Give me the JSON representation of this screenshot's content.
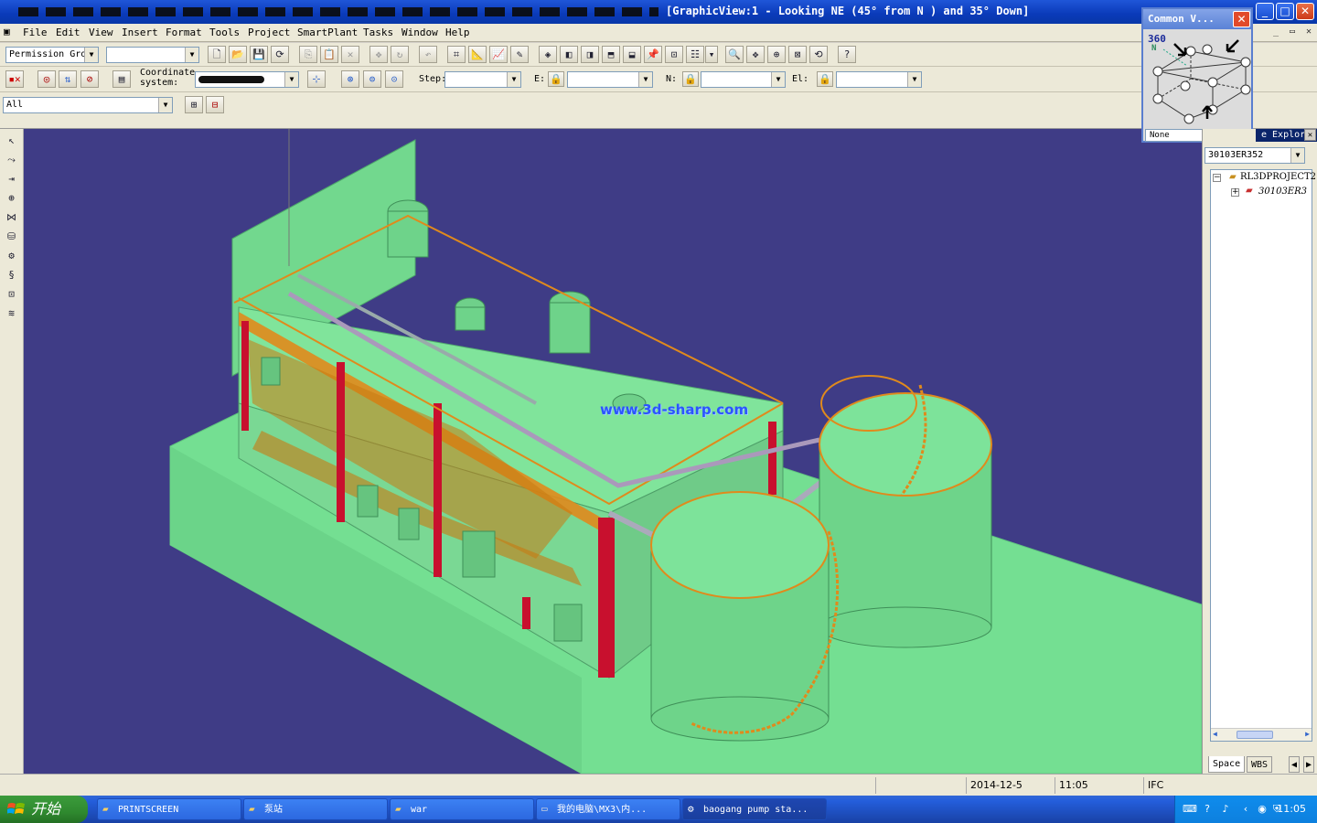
{
  "window": {
    "title": "[GraphicView:1 - Looking NE (45° from N ) and 35° Down]",
    "min": "_",
    "max": "□",
    "close": "✕"
  },
  "menu": [
    "File",
    "Edit",
    "View",
    "Insert",
    "Format",
    "Tools",
    "Project",
    "SmartPlant",
    "Tasks",
    "Window",
    "Help"
  ],
  "mdi": {
    "min": "_",
    "restore": "▭",
    "close": "✕"
  },
  "toolbar1": {
    "permission_group": "Permission Gro",
    "second_combo": ""
  },
  "toolbar2": {
    "coord_label": "Coordinate\nsystem:",
    "step_label": "Step:",
    "e_label": "E:",
    "n_label": "N:",
    "el_label": "El:"
  },
  "toolbar3": {
    "filter": "All"
  },
  "common_views": {
    "title": "Common V...",
    "badge": "360",
    "n": "N",
    "combo": "None",
    "close": "✕"
  },
  "explorer": {
    "title": "e Explor",
    "close": "✕",
    "combo": "30103ER352",
    "tree": [
      {
        "label": "RL3DPROJECT2",
        "expander": "−"
      },
      {
        "label": "30103ER3",
        "expander": "+"
      }
    ],
    "tabs": [
      "Space",
      "WBS"
    ],
    "scroll_left": "◀",
    "scroll_right": "▶"
  },
  "viewport": {
    "watermark": "www.3d-sharp.com"
  },
  "statusbar": {
    "date": "2014-12-5",
    "time": "11:05",
    "mode": "IFC"
  },
  "taskbar": {
    "start": "开始",
    "tasks": [
      {
        "label": "PRINTSCREEN",
        "icon": "folder-icon"
      },
      {
        "label": "泵站",
        "icon": "folder-icon"
      },
      {
        "label": "war",
        "icon": "folder-icon"
      },
      {
        "label": "我的电脑\\MX3\\内...",
        "icon": "drive-icon"
      },
      {
        "label": "baogang pump sta...",
        "icon": "app-icon",
        "active": true
      }
    ],
    "clock": "11:05"
  },
  "colors": {
    "viewport_bg": "#3f3c86",
    "model_green": "#7de39a",
    "steel_red": "#c8102e",
    "railing_orange": "#e08a1c",
    "xp_blue": "#245edb"
  }
}
